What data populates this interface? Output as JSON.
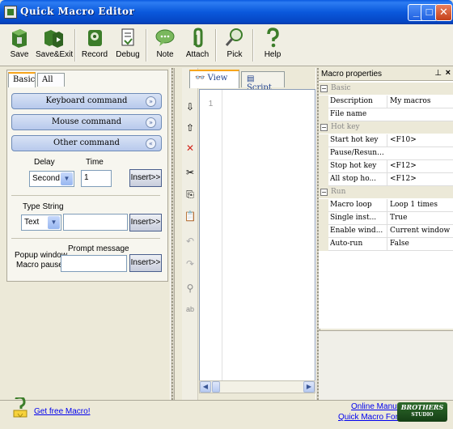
{
  "window": {
    "title": "Quick Macro Editor",
    "minimize": "_",
    "maximize": "□",
    "close": "✕"
  },
  "toolbar": {
    "save": "Save",
    "save_exit": "Save&Exit",
    "record": "Record",
    "debug": "Debug",
    "note": "Note",
    "attach": "Attach",
    "pick": "Pick",
    "help": "Help"
  },
  "left": {
    "tabs": [
      "Basic",
      "All"
    ],
    "sections": [
      "Keyboard command",
      "Mouse command",
      "Other command"
    ],
    "delay_label": "Delay",
    "time_label": "Time",
    "delay_value": "Second",
    "time_value": "1",
    "insert": "Insert>>",
    "type_string_label": "Type String",
    "type_value": "Text",
    "popup_label": "Popup window",
    "macro_pause_label": "Macro pause",
    "prompt_label": "Prompt message"
  },
  "editor": {
    "tabs": [
      "View",
      "Script"
    ],
    "line": "1"
  },
  "props": {
    "title": "Macro properties",
    "groups": {
      "basic": "Basic",
      "hotkey": "Hot key",
      "run": "Run"
    },
    "basic_rows": [
      {
        "k": "Description",
        "v": "My macros"
      },
      {
        "k": "File name",
        "v": ""
      }
    ],
    "hotkey_rows": [
      {
        "k": "Start hot key",
        "v": "<F10>"
      },
      {
        "k": "Pause/Resun...",
        "v": ""
      },
      {
        "k": "Stop hot key",
        "v": "<F12>"
      },
      {
        "k": "All stop ho...",
        "v": "<F12>"
      }
    ],
    "run_rows": [
      {
        "k": "Macro loop",
        "v": "Loop 1 times"
      },
      {
        "k": "Single inst...",
        "v": "True"
      },
      {
        "k": "Enable wind...",
        "v": "Current window"
      },
      {
        "k": "Auto-run",
        "v": "False"
      }
    ]
  },
  "footer": {
    "get_free": "Get free Macro!",
    "online_manual": "Online Manual",
    "forum": "Quick Macro Forum",
    "logo": "BROTHERS",
    "logo_sub": "STUDIO"
  }
}
